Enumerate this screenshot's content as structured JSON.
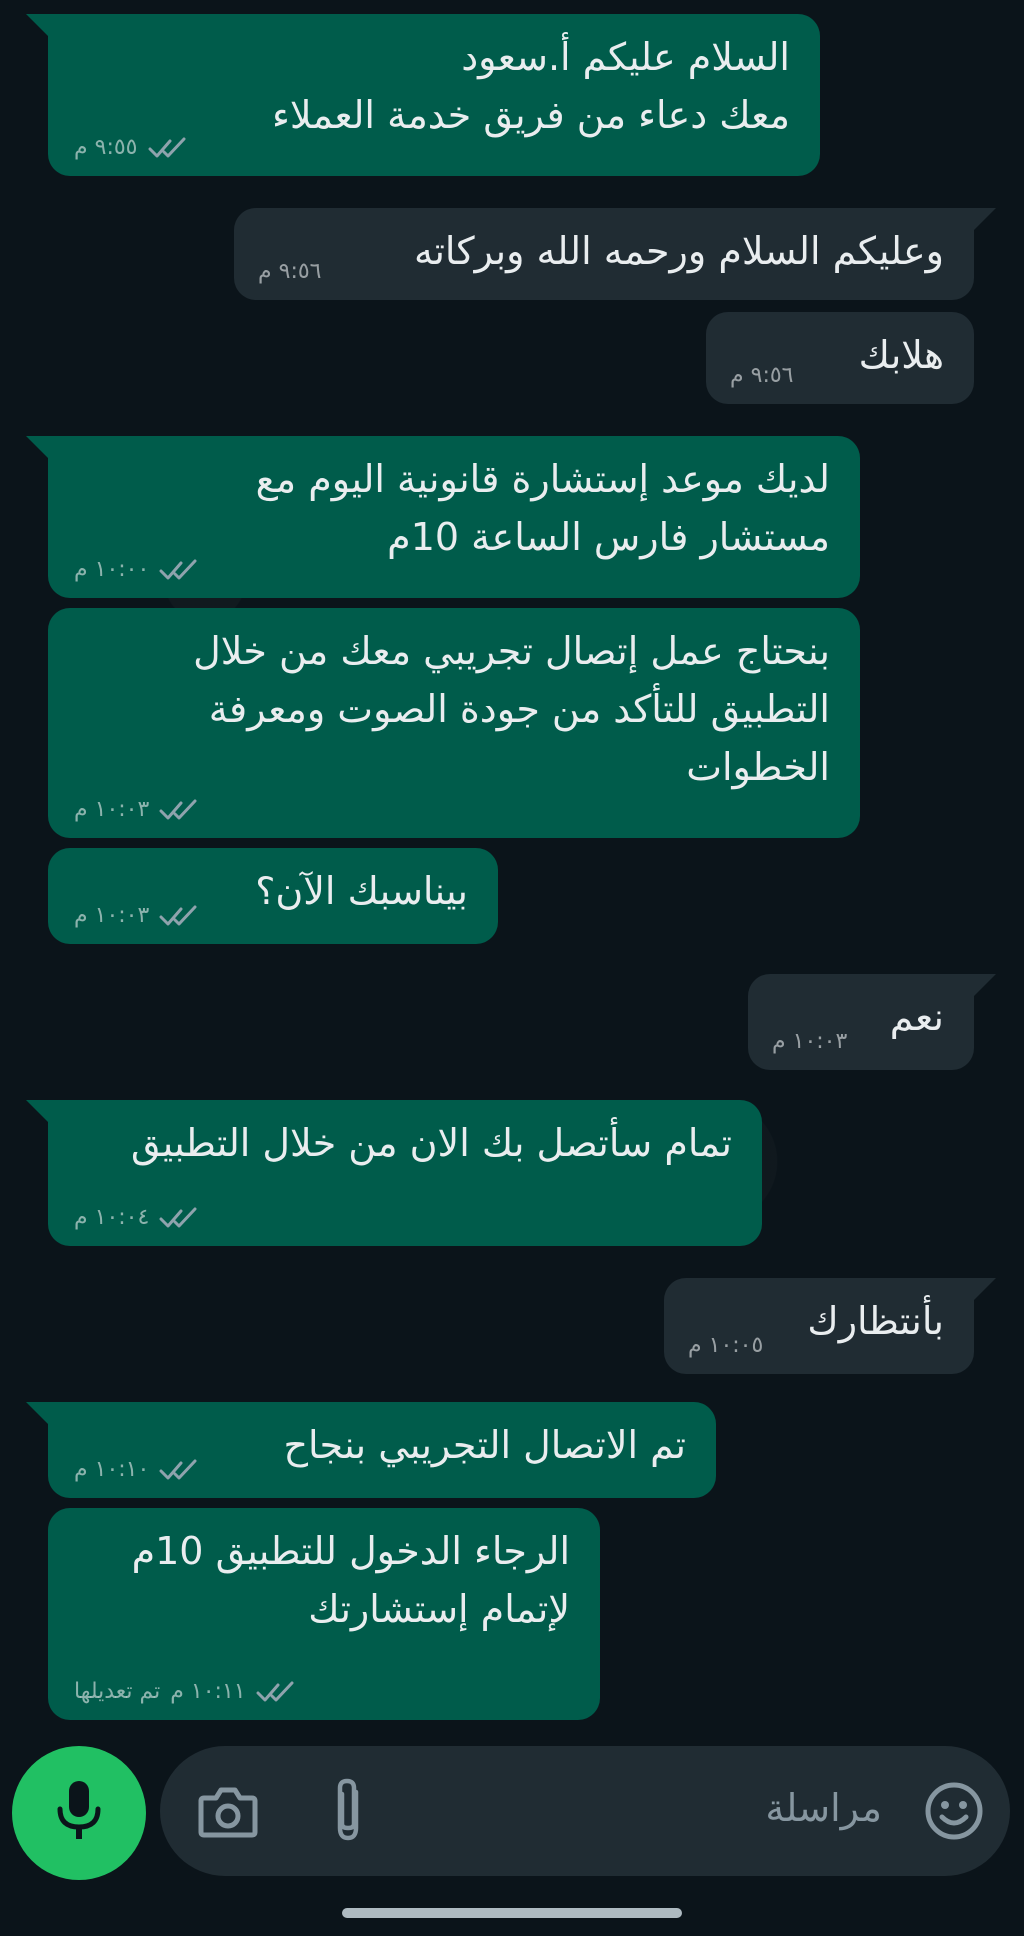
{
  "messages": [
    {
      "lines": [
        "السلام عليكم أ.سعود",
        "معك دعاء من فريق خدمة العملاء"
      ],
      "time": "٩:٥٥ م",
      "dir": "out"
    },
    {
      "lines": [
        "وعليكم السلام ورحمه الله وبركاته"
      ],
      "time": "٩:٥٦ م",
      "dir": "in"
    },
    {
      "lines": [
        "هلابك"
      ],
      "time": "٩:٥٦ م",
      "dir": "in"
    },
    {
      "lines": [
        "لديك موعد إستشارة قانونية اليوم مع",
        "مستشار فارس الساعة 10م"
      ],
      "time": "١٠:٠٠ م",
      "dir": "out"
    },
    {
      "lines": [
        "بنحتاج عمل إتصال تجريبي معك من خلال",
        "التطبيق للتأكد من جودة الصوت ومعرفة",
        "الخطوات"
      ],
      "time": "١٠:٠٣ م",
      "dir": "out"
    },
    {
      "lines": [
        "بيناسبك الآن؟"
      ],
      "time": "١٠:٠٣ م",
      "dir": "out"
    },
    {
      "lines": [
        "نعم"
      ],
      "time": "١٠:٠٣ م",
      "dir": "in"
    },
    {
      "lines": [
        "تمام سأتصل بك الان من خلال التطبيق"
      ],
      "time": "١٠:٠٤ م",
      "dir": "out"
    },
    {
      "lines": [
        "بأنتظارك"
      ],
      "time": "١٠:٠٥ م",
      "dir": "in"
    },
    {
      "lines": [
        "تم الاتصال التجريبي بنجاح"
      ],
      "time": "١٠:١٠ م",
      "dir": "out"
    },
    {
      "lines": [
        "الرجاء الدخول للتطبيق 10م",
        "لإتمام إستشارتك"
      ],
      "time": "١٠:١١ م",
      "edited": "تم تعديلها",
      "dir": "out"
    }
  ],
  "composer": {
    "placeholder": "مراسلة",
    "icons": [
      "emoji-icon",
      "attach-icon",
      "camera-icon",
      "mic-icon"
    ]
  },
  "colors": {
    "background": "#0b141a",
    "outgoing": "#005c4b",
    "incoming": "#202c33",
    "accent": "#21c063"
  }
}
